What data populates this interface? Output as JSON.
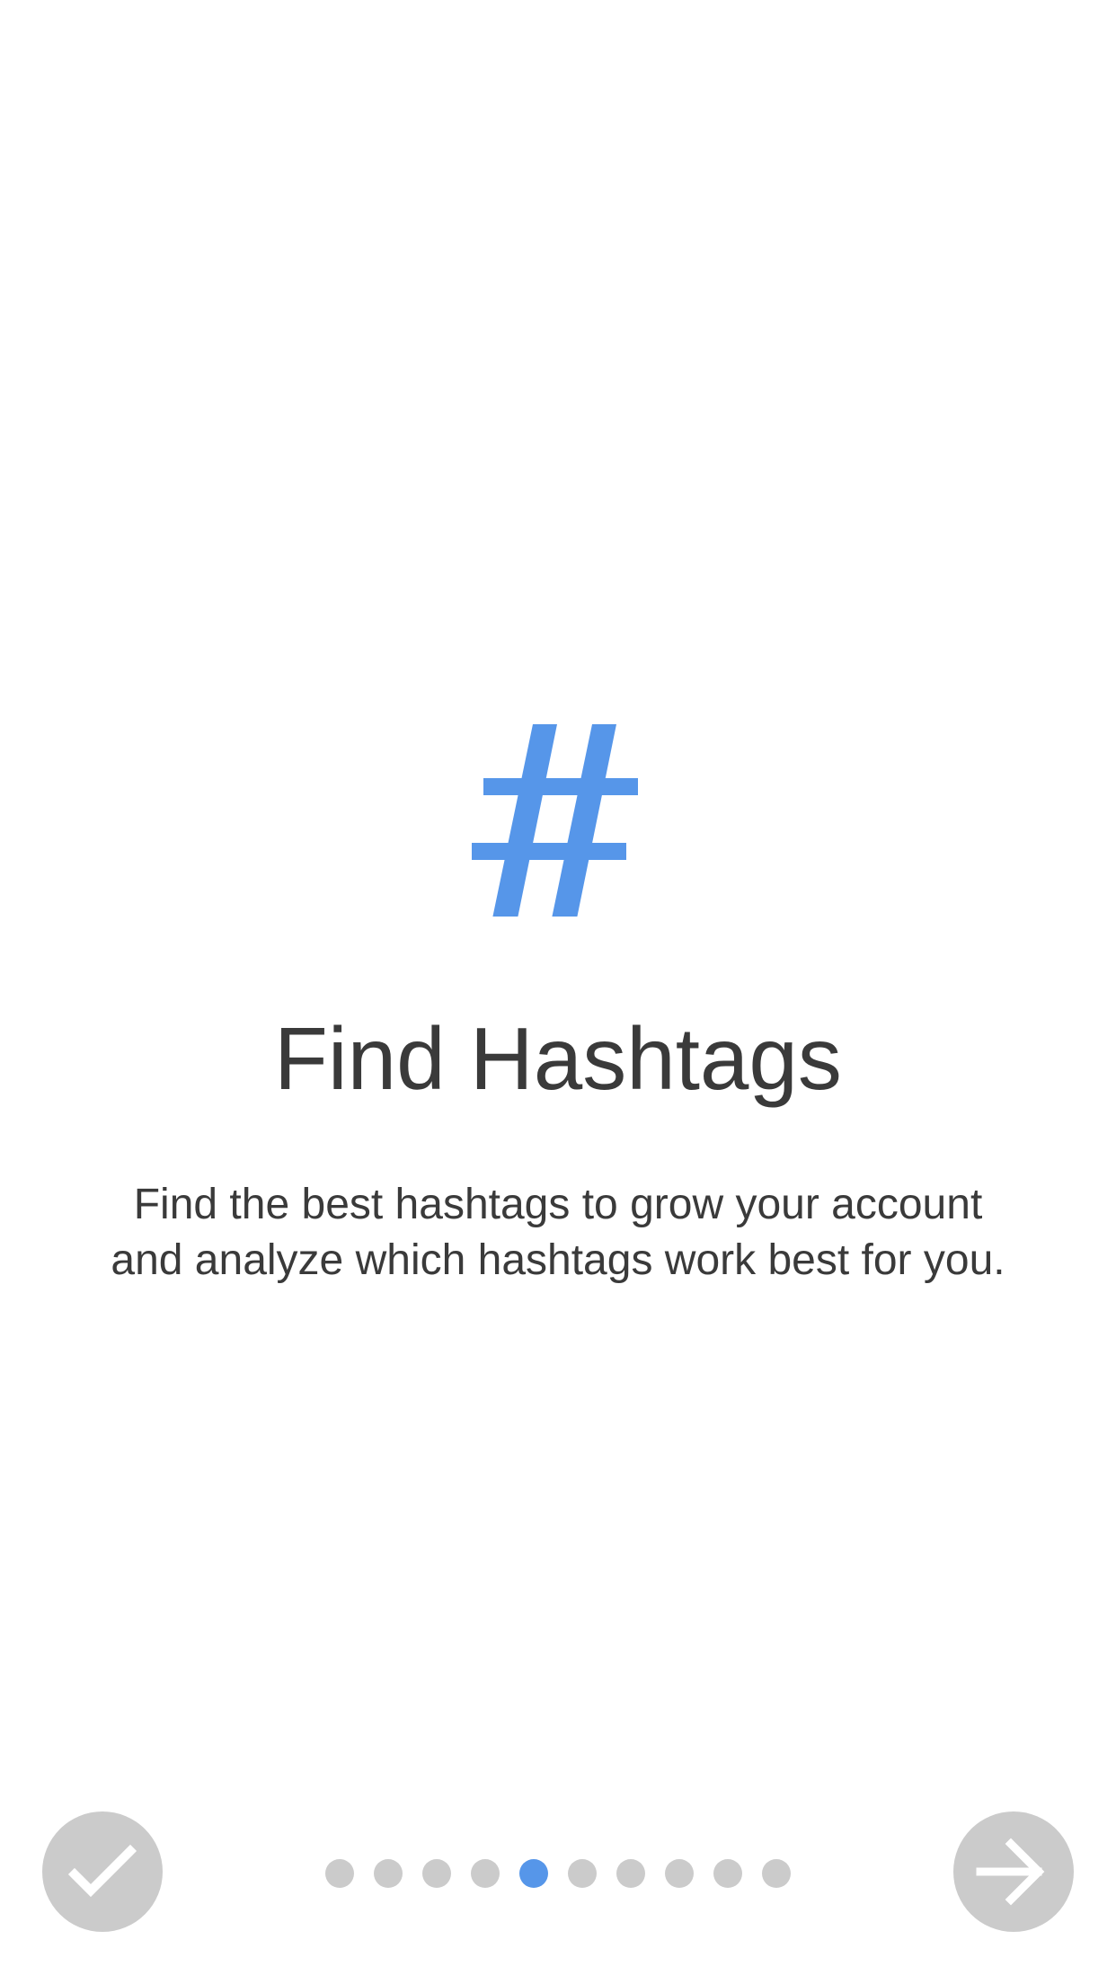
{
  "onboarding": {
    "icon": "hashtag-icon",
    "title": "Find Hashtags",
    "description_lines": [
      "Find the best hashtags to grow your account",
      "and analyze which hashtags work best for you."
    ]
  },
  "pagination": {
    "total_pages": 10,
    "current_page": 5
  },
  "controls": {
    "done_icon": "checkmark-icon",
    "next_icon": "arrow-right-icon"
  },
  "colors": {
    "accent": "#5696e9",
    "inactive": "#cbcbcb",
    "text": "#3a3a3a",
    "background": "#ffffff"
  }
}
